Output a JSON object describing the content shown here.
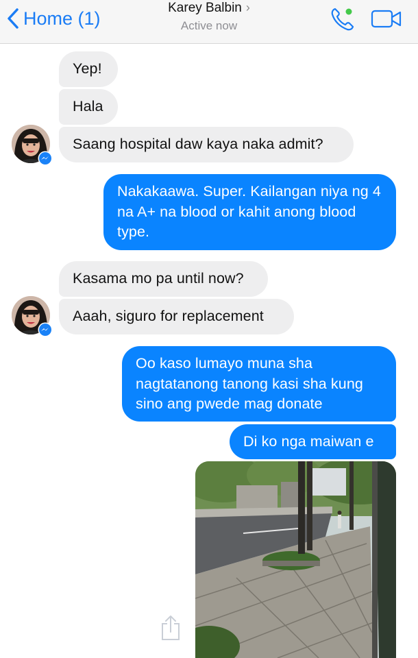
{
  "header": {
    "back_label": "Home (1)",
    "contact_name": "Karey Balbin",
    "status": "Active now",
    "icons": {
      "back": "chevron-left-icon",
      "name_chevron": "chevron-right-icon",
      "call": "phone-icon",
      "video": "video-camera-icon"
    },
    "colors": {
      "accent": "#1a7cf5",
      "online": "#44c94a"
    }
  },
  "messages": [
    {
      "from": "contact",
      "text": "Yep!"
    },
    {
      "from": "contact",
      "text": "Hala"
    },
    {
      "from": "contact",
      "text": "Saang hospital daw kaya naka admit?"
    },
    {
      "from": "me",
      "text": "Nakakaawa. Super. Kailangan niya ng 4 na A+ na blood or kahit anong blood type."
    },
    {
      "from": "contact",
      "text": "Kasama mo pa until now?"
    },
    {
      "from": "contact",
      "text": "Aaah, siguro for replacement"
    },
    {
      "from": "me",
      "text": "Oo kaso lumayo muna sha nagtatanong tanong kasi sha kung sino ang pwede mag donate"
    },
    {
      "from": "me",
      "text": "Di ko nga maiwan e"
    },
    {
      "from": "me",
      "type": "photo",
      "content": "street sidewalk with trees"
    }
  ],
  "colors": {
    "incoming_bubble": "#eeeeef",
    "outgoing_bubble": "#0a84ff",
    "messenger_badge": "#1a82f7"
  },
  "share_icon": "share-icon"
}
